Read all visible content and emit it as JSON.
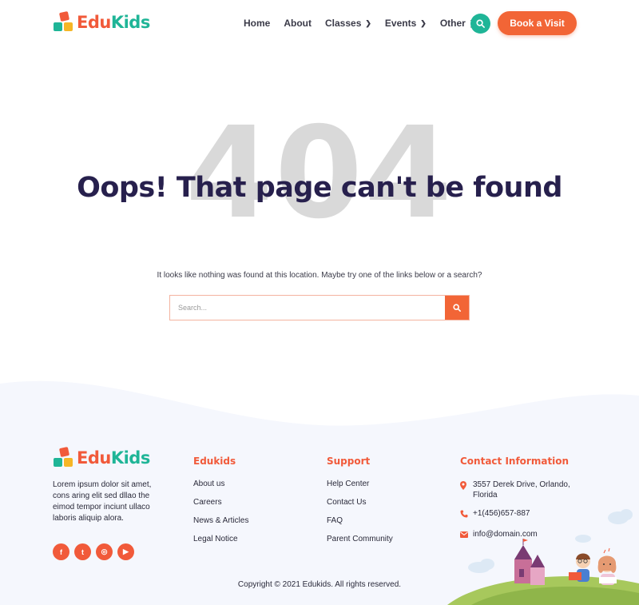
{
  "brand": {
    "logo_left": "Edu",
    "logo_right": "Kids"
  },
  "nav": {
    "items": [
      {
        "label": "Home",
        "dropdown": false
      },
      {
        "label": "About",
        "dropdown": false
      },
      {
        "label": "Classes",
        "dropdown": true
      },
      {
        "label": "Events",
        "dropdown": true
      },
      {
        "label": "Other",
        "dropdown": true
      }
    ],
    "search_icon": "search-icon",
    "cta_label": "Book a Visit"
  },
  "error": {
    "code": "404",
    "title": "Oops! That page can't be found",
    "message": "It looks like nothing was found at this location. Maybe try one of the links below or a search?",
    "search_placeholder": "Search..."
  },
  "footer": {
    "about": "Lorem ipsum dolor sit amet, cons aring elit sed dllao the eimod tempor inciunt ullaco laboris aliquip alora.",
    "socials": [
      {
        "name": "facebook-icon",
        "glyph": "f"
      },
      {
        "name": "twitter-icon",
        "glyph": "t"
      },
      {
        "name": "instagram-icon",
        "glyph": "◎"
      },
      {
        "name": "youtube-icon",
        "glyph": "▶"
      }
    ],
    "columns": {
      "edukids": {
        "title": "Edukids",
        "links": [
          "About us",
          "Careers",
          "News & Articles",
          "Legal Notice"
        ]
      },
      "support": {
        "title": "Support",
        "links": [
          "Help Center",
          "Contact Us",
          "FAQ",
          "Parent Community"
        ]
      },
      "contact": {
        "title": "Contact Information",
        "address": "3557 Derek Drive, Orlando, Florida",
        "phone": "+1(456)657-887",
        "email": "info@domain.com"
      }
    },
    "copyright": "Copyright © 2021 Edukids. All rights reserved."
  },
  "colors": {
    "accent_orange": "#f26536",
    "accent_teal": "#1fb597",
    "title_navy": "#27204d",
    "footer_bg": "#f5f7fd"
  }
}
